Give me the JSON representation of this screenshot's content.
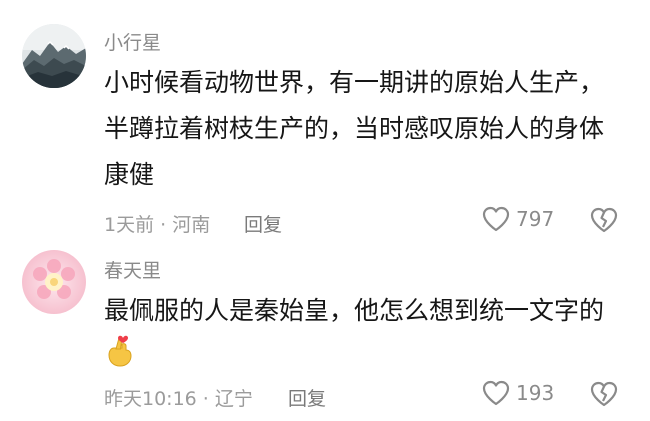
{
  "comments": [
    {
      "username": "小行星",
      "lines": [
        "小时候看动物世界，有一期讲的原始人生产，",
        "半蹲拉着树枝生产的，当时感叹原始人的身体",
        "康健"
      ],
      "meta": "1天前 · 河南",
      "reply_label": "回复",
      "like_count": "797",
      "avatar_icon": "mountain-landscape-avatar"
    },
    {
      "username": "春天里",
      "lines": [
        "最佩服的人是秦始皇，他怎么想到统一文字的"
      ],
      "emoji_icon": "finger-heart-emoji",
      "meta": "昨天10:16 · 辽宁",
      "reply_label": "回复",
      "like_count": "193",
      "avatar_icon": "pink-flower-avatar"
    }
  ],
  "colors": {
    "text_primary": "#161616",
    "text_secondary": "#9b9b9b",
    "icon_gray": "#8a8a8a"
  }
}
